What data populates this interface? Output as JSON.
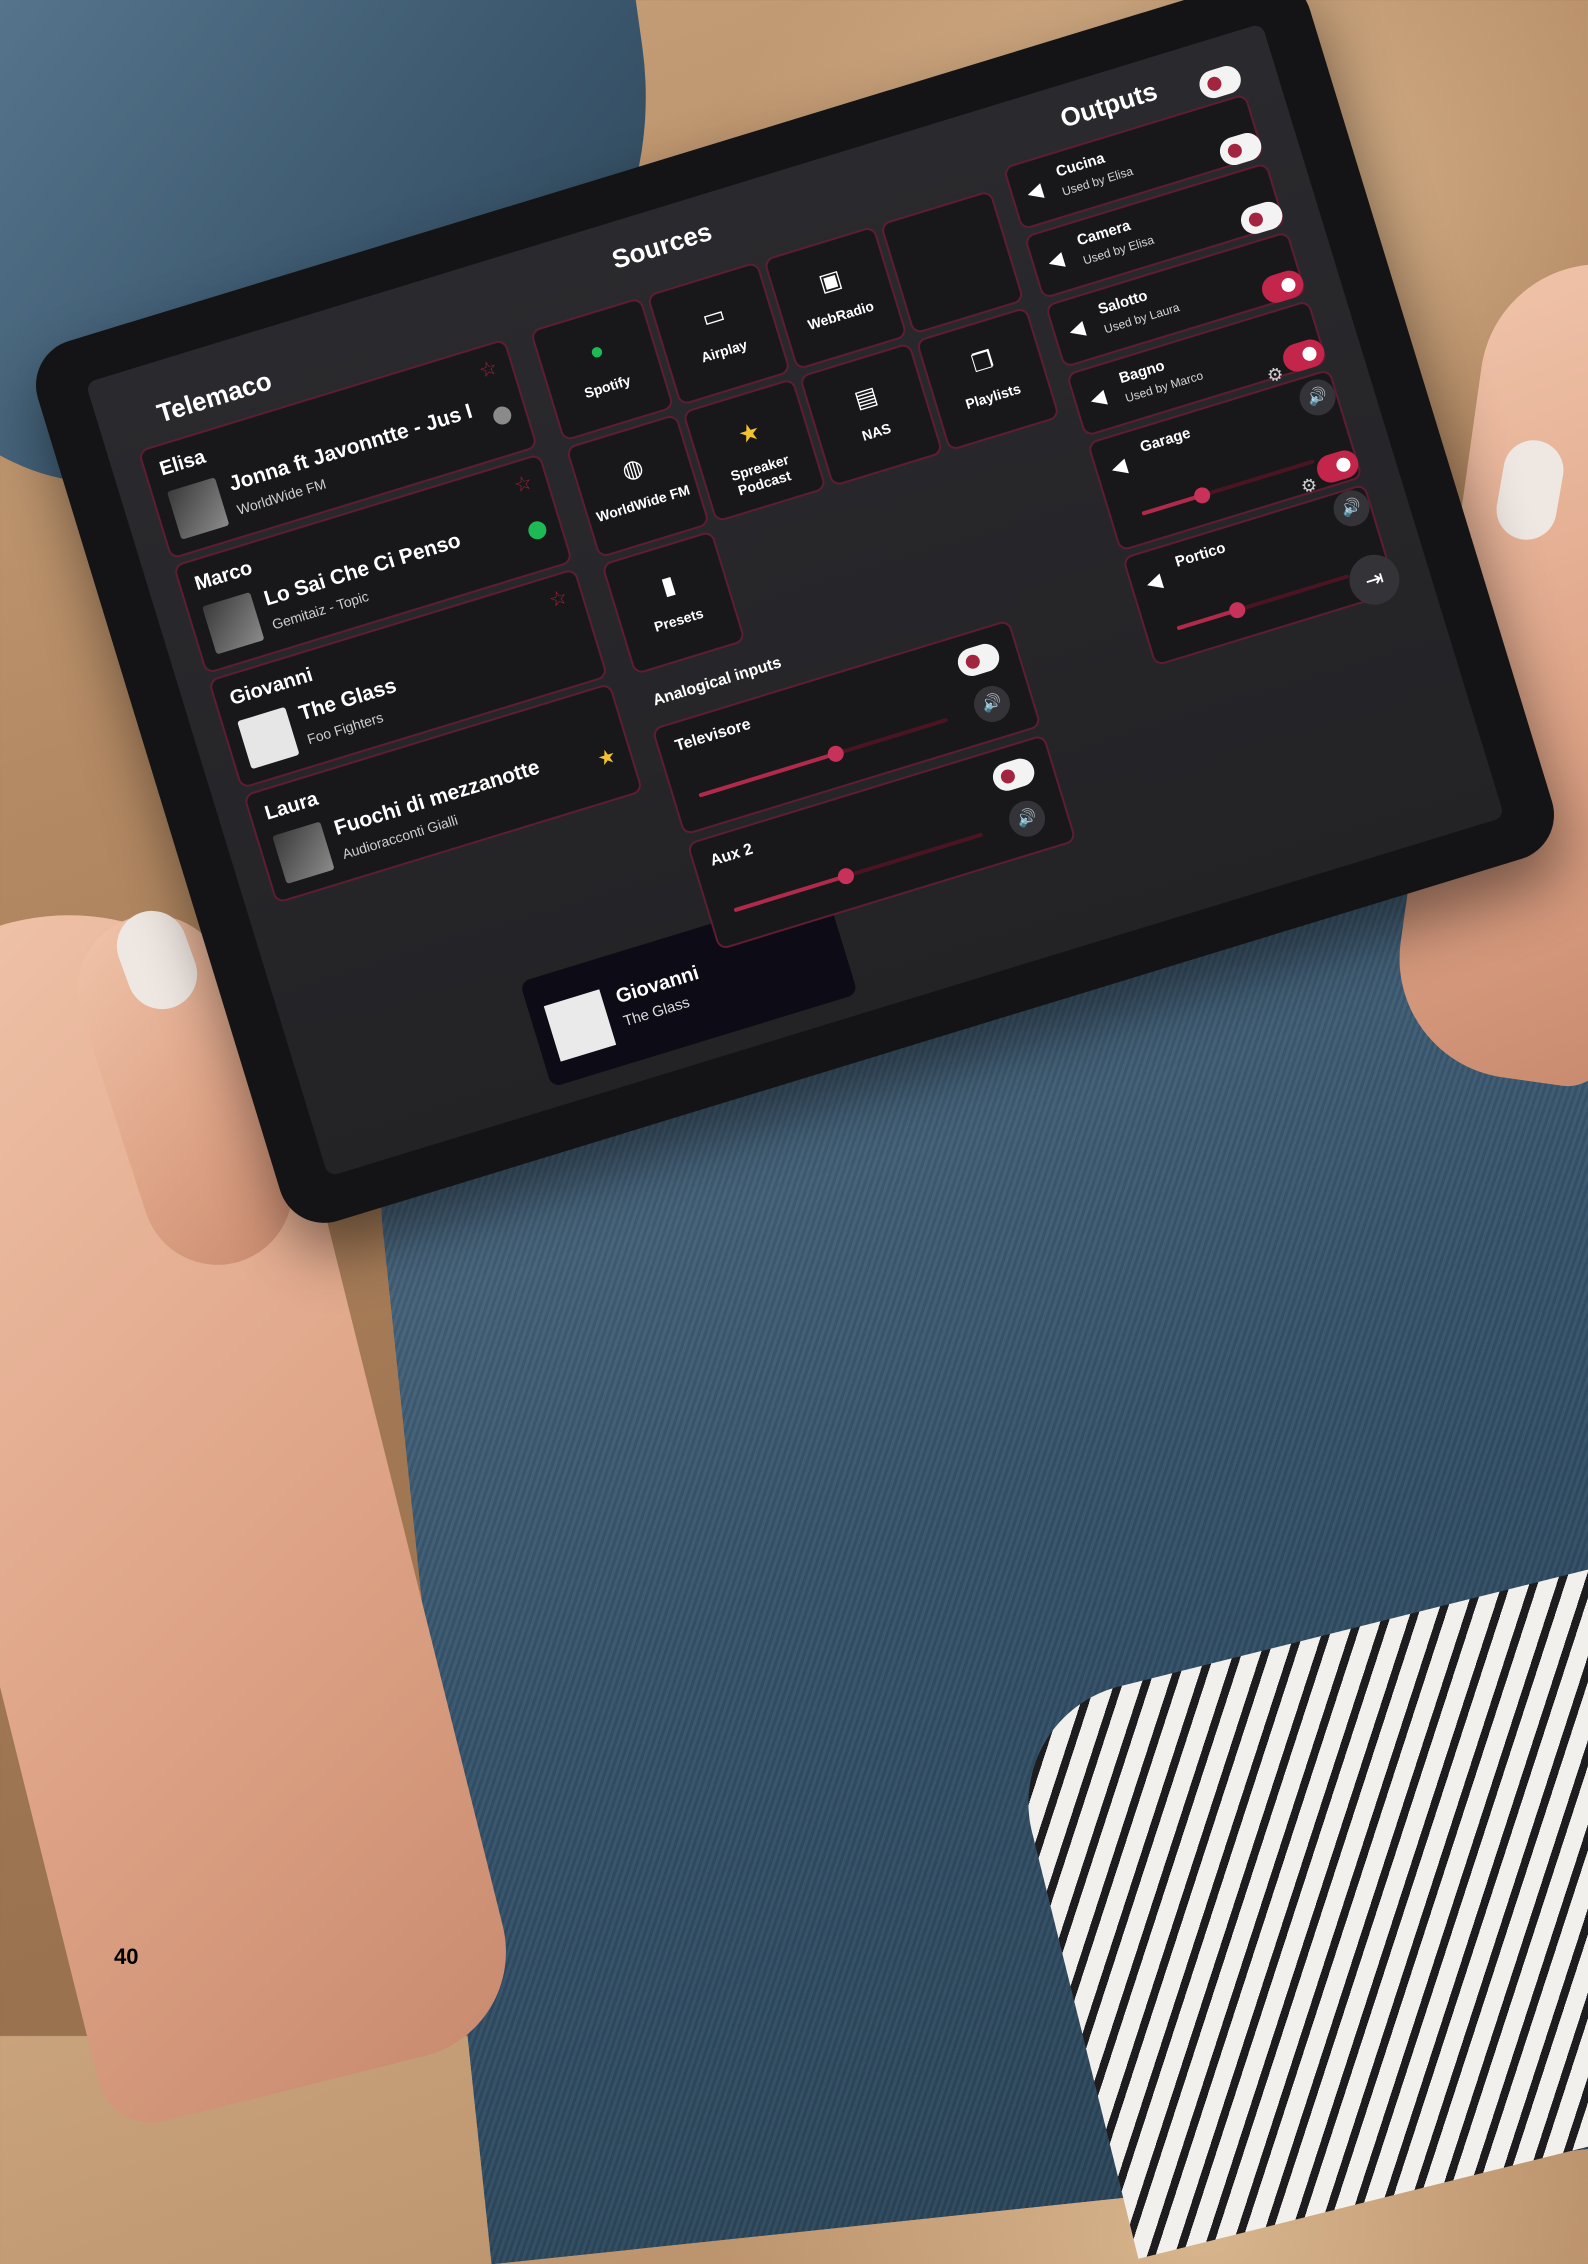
{
  "columns": {
    "zones_title": "Telemaco",
    "sources_title": "Sources",
    "outputs_title": "Outputs"
  },
  "zones": [
    {
      "user": "Elisa",
      "song": "Jonna ft Javonntte - Jus I",
      "artist": "WorldWide FM",
      "badge": "globe-icon"
    },
    {
      "user": "Marco",
      "song": "Lo Sai Che Ci Penso",
      "artist": "Gemitaiz - Topic",
      "badge": "spotify-icon"
    },
    {
      "user": "Giovanni",
      "song": "The Glass",
      "artist": "Foo Fighters",
      "badge": "none"
    },
    {
      "user": "Laura",
      "song": "Fuochi di mezzanotte",
      "artist": "Audioracconti Gialli",
      "badge": "star-icon"
    }
  ],
  "now_playing": {
    "user": "Giovanni",
    "song": "The Glass"
  },
  "sources": [
    {
      "label": "Spotify",
      "icon": "spotify-icon"
    },
    {
      "label": "Airplay",
      "icon": "airplay-icon"
    },
    {
      "label": "WebRadio",
      "icon": "radio-icon"
    },
    {
      "label": "",
      "icon": "none"
    },
    {
      "label": "WorldWide FM",
      "icon": "globe-icon"
    },
    {
      "label": "Spreaker Podcast",
      "icon": "star-icon"
    },
    {
      "label": "NAS",
      "icon": "server-icon"
    },
    {
      "label": "Playlists",
      "icon": "playlist-icon"
    },
    {
      "label": "Presets",
      "icon": "bookmark-icon"
    }
  ],
  "analog_section_label": "Analogical inputs",
  "analog_inputs": [
    {
      "name": "Televisore",
      "volume": 0.55,
      "enabled": false
    },
    {
      "name": "Aux 2",
      "volume": 0.45,
      "enabled": false
    }
  ],
  "outputs": [
    {
      "name": "Cucina",
      "used_by": "Used by Elisa",
      "enabled": false
    },
    {
      "name": "Camera",
      "used_by": "Used by Elisa",
      "enabled": false
    },
    {
      "name": "Salotto",
      "used_by": "Used by Laura",
      "enabled": false
    },
    {
      "name": "Bagno",
      "used_by": "Used by Marco",
      "enabled": true
    },
    {
      "name": "Garage",
      "used_by": "",
      "volume": 0.35,
      "enabled": true
    },
    {
      "name": "Portico",
      "used_by": "",
      "volume": 0.35,
      "enabled": true
    }
  ],
  "page_number": "40",
  "colors": {
    "accent": "#a3243f",
    "panel": "#18181a",
    "border": "#5e1d31",
    "screen_bg": "#2a2a2e"
  }
}
